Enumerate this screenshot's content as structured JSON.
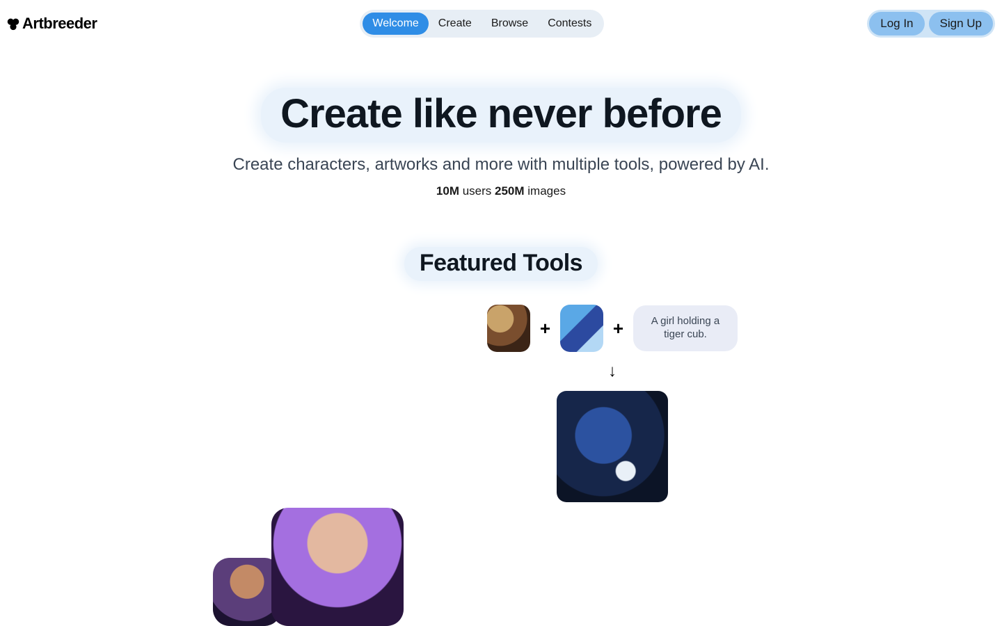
{
  "logo": {
    "text": "Artbreeder"
  },
  "nav": {
    "items": [
      {
        "label": "Welcome",
        "active": true
      },
      {
        "label": "Create",
        "active": false
      },
      {
        "label": "Browse",
        "active": false
      },
      {
        "label": "Contests",
        "active": false
      }
    ]
  },
  "auth": {
    "login": "Log In",
    "signup": "Sign Up"
  },
  "hero": {
    "title": "Create like never before",
    "subtitle": "Create characters, artworks and more with multiple tools, powered by AI.",
    "users_count": "10M",
    "users_label": " users  ",
    "images_count": "250M",
    "images_label": " images"
  },
  "featured": {
    "title": "Featured Tools",
    "composer": {
      "plus": "+",
      "arrow": "↓",
      "prompt": "A girl holding a tiger cub."
    }
  }
}
